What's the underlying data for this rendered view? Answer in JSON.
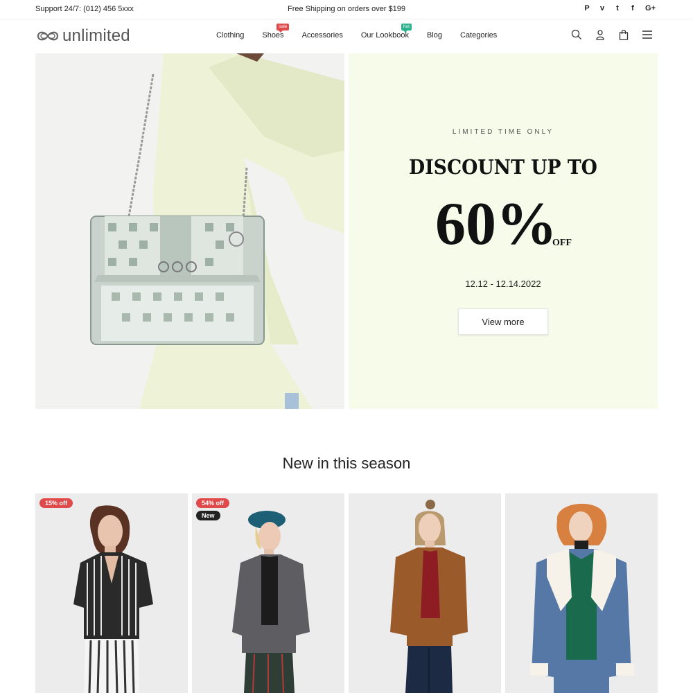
{
  "topbar": {
    "support": "Support 24/7: (012) 456 5xxx",
    "shipping": "Free Shipping on orders over $199",
    "socials": [
      "pinterest-icon",
      "vimeo-icon",
      "twitter-icon",
      "facebook-icon",
      "google-plus-icon"
    ],
    "social_glyphs": [
      "P",
      "v",
      "t",
      "f",
      "G+"
    ]
  },
  "header": {
    "logo_text": "unlimited",
    "nav": [
      {
        "label": "Clothing"
      },
      {
        "label": "Shoes",
        "badge": "sale"
      },
      {
        "label": "Accessories"
      },
      {
        "label": "Our Lookbook",
        "badge": "hot"
      },
      {
        "label": "Blog"
      },
      {
        "label": "Categories"
      }
    ],
    "icons": [
      "search-icon",
      "user-icon",
      "bag-icon",
      "menu-icon"
    ]
  },
  "hero": {
    "kicker": "LIMITED TIME ONLY",
    "headline": "DISCOUNT UP TO",
    "percent": "60%",
    "off": "OFF",
    "dates": "12.12 - 12.14.2022",
    "button": "View more",
    "colors": {
      "panel": "#f6fbea"
    }
  },
  "section": {
    "title": "New in this season",
    "products": [
      {
        "tags": [
          "15% off"
        ]
      },
      {
        "tags": [
          "54% off",
          "New"
        ]
      },
      {
        "tags": []
      },
      {
        "tags": []
      }
    ]
  },
  "colors": {
    "sale": "#e04a4a",
    "hot": "#2bb18c",
    "dark_tag": "#222222"
  }
}
